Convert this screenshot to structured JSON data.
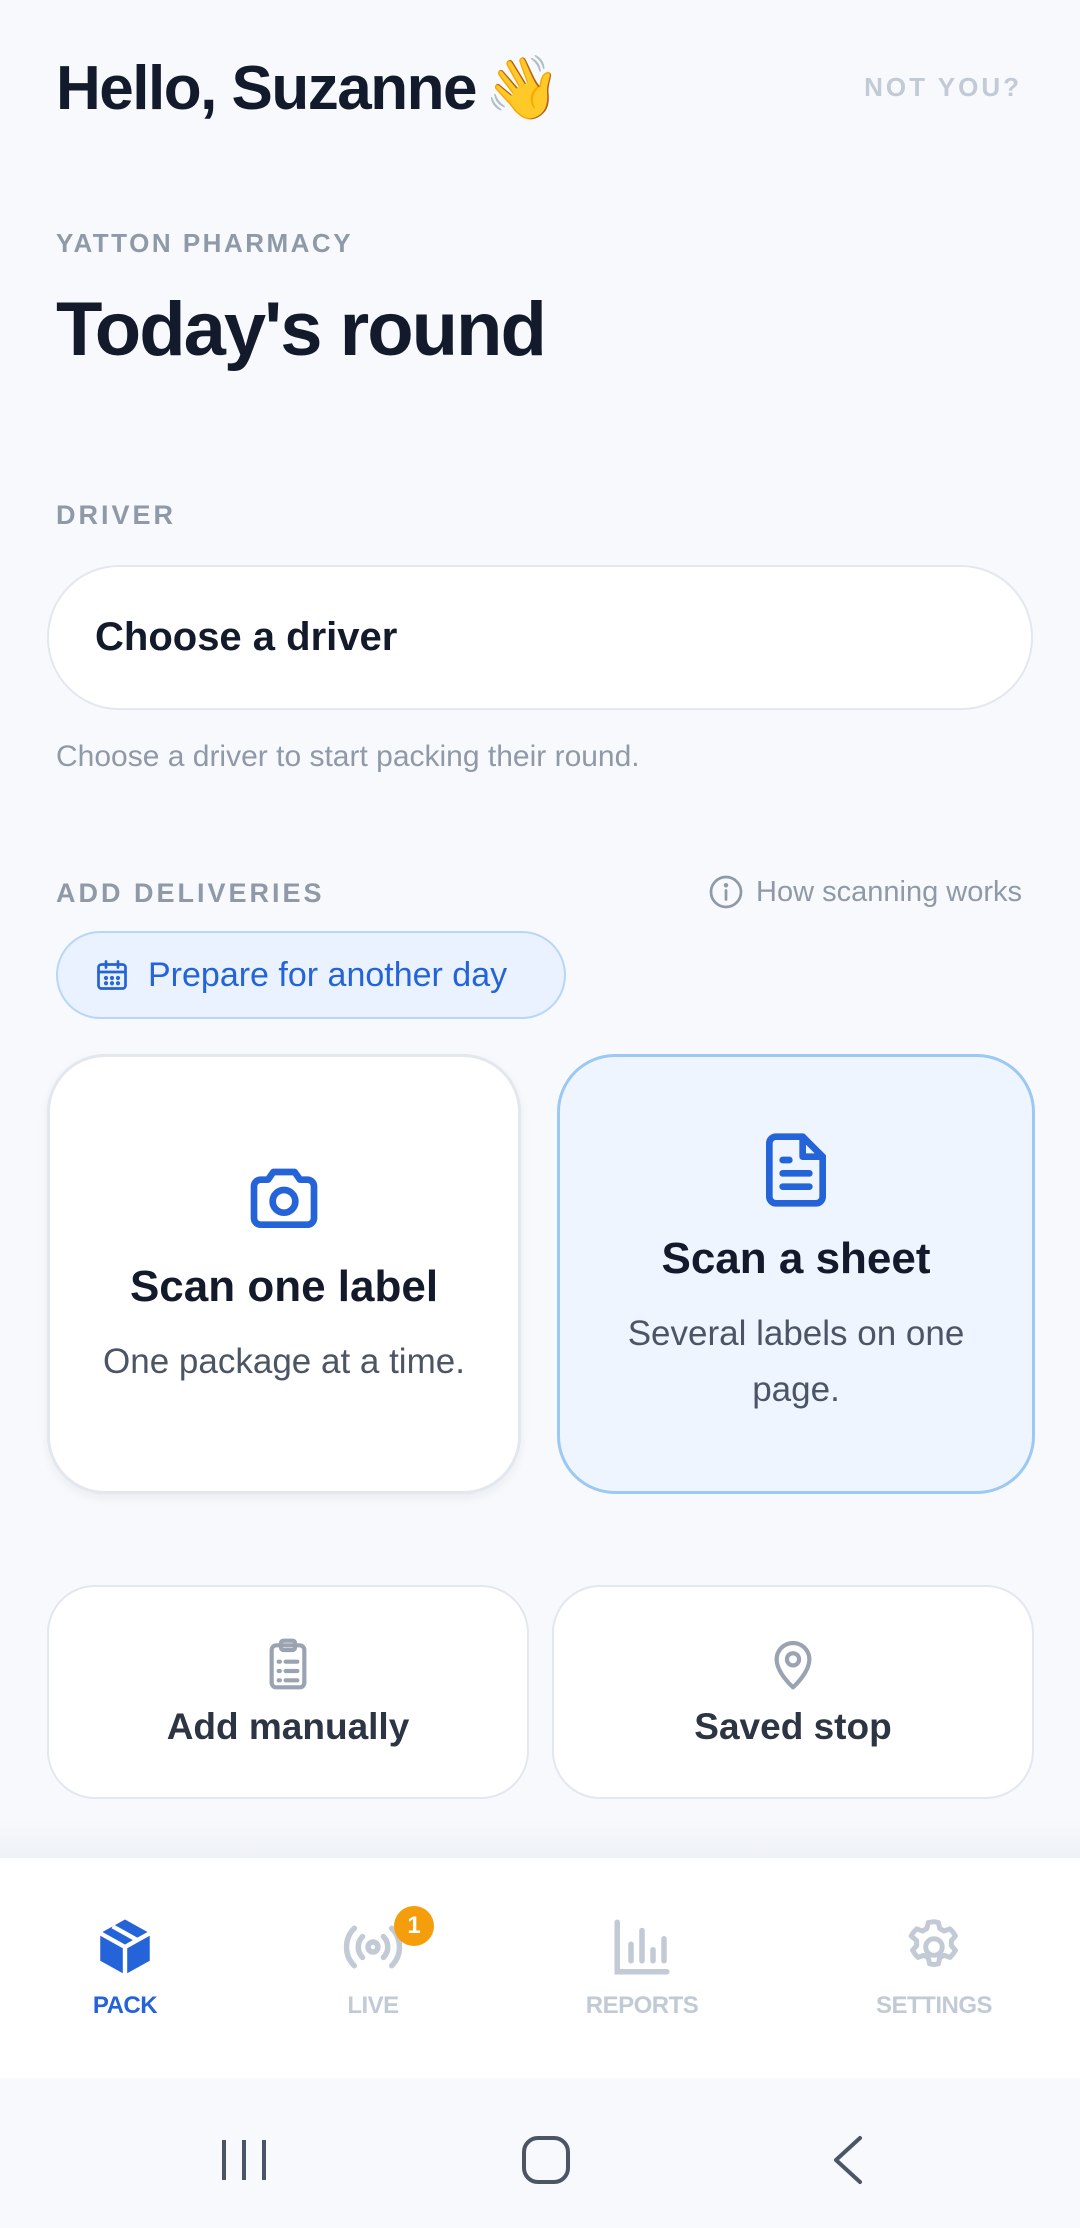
{
  "header": {
    "greeting": "Hello, Suzanne",
    "greeting_emoji": "👋",
    "not_you": "NOT YOU?"
  },
  "pharmacy_name": "YATTON PHARMACY",
  "page_title": "Today's round",
  "driver": {
    "label": "DRIVER",
    "select_value": "Choose a driver",
    "helper_text": "Choose a driver to start packing their round."
  },
  "deliveries": {
    "label": "ADD DELIVERIES",
    "how_link": "How scanning works",
    "prepare_button": "Prepare for another day",
    "scan_one": {
      "title": "Scan one label",
      "subtitle": "One package at a time.",
      "icon": "camera-icon"
    },
    "scan_sheet": {
      "title": "Scan a sheet",
      "subtitle": "Several labels on one page.",
      "icon": "document-icon"
    },
    "add_manually": {
      "title": "Add manually",
      "icon": "clipboard-icon"
    },
    "saved_stop": {
      "title": "Saved stop",
      "icon": "map-pin-icon"
    }
  },
  "nav": {
    "pack": "PACK",
    "live": "LIVE",
    "live_badge": "1",
    "reports": "REPORTS",
    "settings": "SETTINGS"
  },
  "colors": {
    "accent": "#2563d8",
    "badge": "#f59e0b",
    "muted": "#8f99a8"
  }
}
